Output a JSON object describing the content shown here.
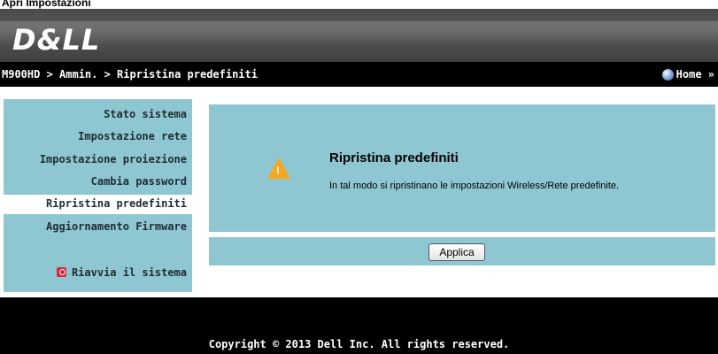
{
  "page": {
    "title": "Apri Impostazioni"
  },
  "banner": {
    "logo": "D&LL"
  },
  "nav": {
    "breadcrumb": "M900HD > Ammin. > Ripristina predefiniti",
    "home": "Home »"
  },
  "sidebar": {
    "items": [
      {
        "label": "Stato sistema"
      },
      {
        "label": "Impostazione rete"
      },
      {
        "label": "Impostazione proiezione"
      },
      {
        "label": "Cambia password"
      },
      {
        "label": "Ripristina predefiniti"
      },
      {
        "label": "Aggiornamento Firmware"
      }
    ],
    "restart": "Riavvia il sistema"
  },
  "main": {
    "title": "Ripristina predefiniti",
    "description": "In tal modo si ripristinano le impostazioni Wireless/Rete predefinite.",
    "apply_label": "Applica"
  },
  "footer": {
    "copyright": "Copyright © 2013 Dell Inc. All rights reserved."
  },
  "icons": [
    "globe-icon",
    "warning-icon",
    "restart-icon"
  ],
  "colors": {
    "panel": "#8ec7d2",
    "bar": "#000000",
    "warning": "#f5a81e",
    "restart": "#d8263a"
  }
}
